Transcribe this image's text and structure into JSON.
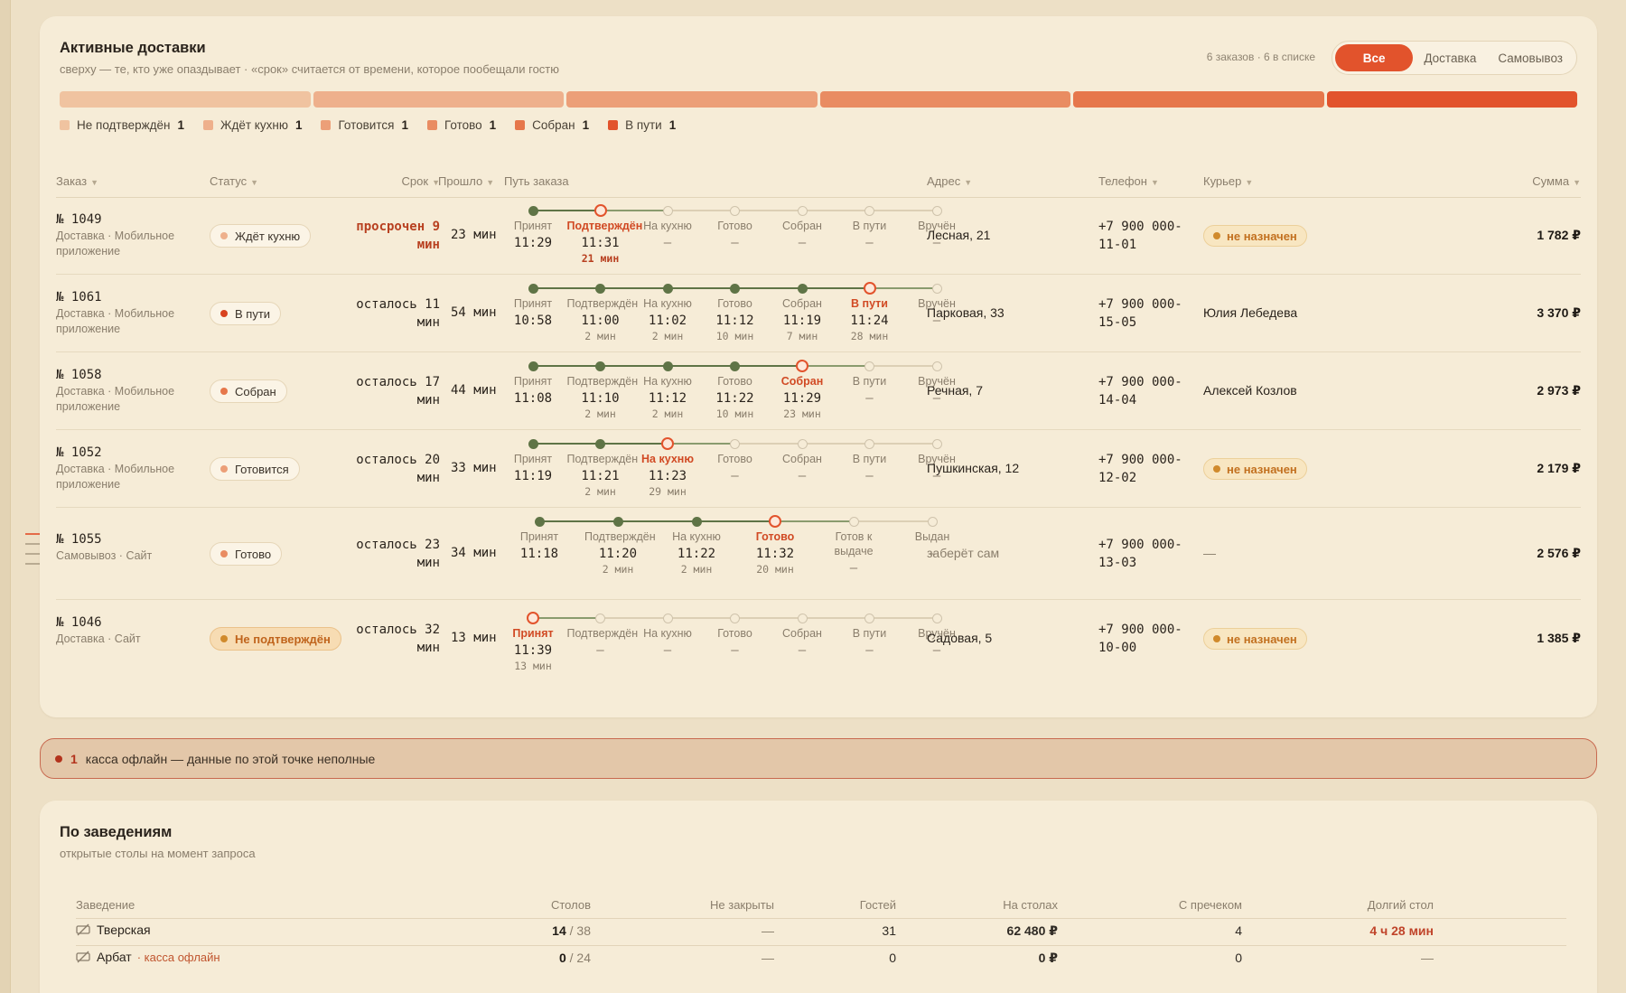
{
  "deliveries": {
    "title": "Активные доставки",
    "subtitle": "сверху — те, кто уже опаздывает · «срок» считается от времени, которое пообещали гостю",
    "counts": "6 заказов · 6 в списке",
    "filters": [
      "Все",
      "Доставка",
      "Самовывоз"
    ],
    "active_filter": "Все",
    "legend": [
      {
        "label": "Не подтверждён",
        "count": "1",
        "color": "#f0c3a0"
      },
      {
        "label": "Ждёт кухню",
        "count": "1",
        "color": "#eeb08c"
      },
      {
        "label": "Готовится",
        "count": "1",
        "color": "#ec9f78"
      },
      {
        "label": "Готово",
        "count": "1",
        "color": "#e98c62"
      },
      {
        "label": "Собран",
        "count": "1",
        "color": "#e6774b"
      },
      {
        "label": "В пути",
        "count": "1",
        "color": "#e2532c"
      }
    ],
    "columns": [
      "Заказ",
      "Статус",
      "Срок",
      "Прошло",
      "Путь заказа",
      "Адрес",
      "Телефон",
      "Курьер",
      "Сумма"
    ],
    "orders": [
      {
        "number": "№ 1049",
        "meta": "Доставка · Мобильное приложение",
        "status": "Ждёт кухню",
        "status_color": "#eeb08c",
        "status_warn": false,
        "deadline": "просрочен 9 мин",
        "late": true,
        "elapsed": "23 мин",
        "steps": [
          {
            "name": "Принят",
            "time": "11:29",
            "dur": ""
          },
          {
            "name": "Подтверждён",
            "time": "11:31",
            "dur": "21 мин"
          },
          {
            "name": "На кухню",
            "time": "—",
            "dur": ""
          },
          {
            "name": "Готово",
            "time": "—",
            "dur": ""
          },
          {
            "name": "Собран",
            "time": "—",
            "dur": ""
          },
          {
            "name": "В пути",
            "time": "—",
            "dur": ""
          },
          {
            "name": "Вручён",
            "time": "—",
            "dur": ""
          }
        ],
        "current": 1,
        "address": "Лесная, 21",
        "phone": "+7 900 000-11-01",
        "courier": "не назначен",
        "courier_unassigned": true,
        "sum": "1 782 ₽"
      },
      {
        "number": "№ 1061",
        "meta": "Доставка · Мобильное приложение",
        "status": "В пути",
        "status_color": "#d8421f",
        "status_warn": false,
        "deadline": "осталось 11 мин",
        "late": false,
        "elapsed": "54 мин",
        "steps": [
          {
            "name": "Принят",
            "time": "10:58",
            "dur": ""
          },
          {
            "name": "Подтверждён",
            "time": "11:00",
            "dur": "2 мин"
          },
          {
            "name": "На кухню",
            "time": "11:02",
            "dur": "2 мин"
          },
          {
            "name": "Готово",
            "time": "11:12",
            "dur": "10 мин"
          },
          {
            "name": "Собран",
            "time": "11:19",
            "dur": "7 мин"
          },
          {
            "name": "В пути",
            "time": "11:24",
            "dur": "28 мин"
          },
          {
            "name": "Вручён",
            "time": "—",
            "dur": ""
          }
        ],
        "current": 5,
        "address": "Парковая, 33",
        "phone": "+7 900 000-15-05",
        "courier": "Юлия Лебедева",
        "courier_unassigned": false,
        "sum": "3 370 ₽"
      },
      {
        "number": "№ 1058",
        "meta": "Доставка · Мобильное приложение",
        "status": "Собран",
        "status_color": "#e6774b",
        "status_warn": false,
        "deadline": "осталось 17 мин",
        "late": false,
        "elapsed": "44 мин",
        "steps": [
          {
            "name": "Принят",
            "time": "11:08",
            "dur": ""
          },
          {
            "name": "Подтверждён",
            "time": "11:10",
            "dur": "2 мин"
          },
          {
            "name": "На кухню",
            "time": "11:12",
            "dur": "2 мин"
          },
          {
            "name": "Готово",
            "time": "11:22",
            "dur": "10 мин"
          },
          {
            "name": "Собран",
            "time": "11:29",
            "dur": "23 мин"
          },
          {
            "name": "В пути",
            "time": "—",
            "dur": ""
          },
          {
            "name": "Вручён",
            "time": "—",
            "dur": ""
          }
        ],
        "current": 4,
        "address": "Речная, 7",
        "phone": "+7 900 000-14-04",
        "courier": "Алексей Козлов",
        "courier_unassigned": false,
        "sum": "2 973 ₽"
      },
      {
        "number": "№ 1052",
        "meta": "Доставка · Мобильное приложение",
        "status": "Готовится",
        "status_color": "#ec9f78",
        "status_warn": false,
        "deadline": "осталось 20 мин",
        "late": false,
        "elapsed": "33 мин",
        "steps": [
          {
            "name": "Принят",
            "time": "11:19",
            "dur": ""
          },
          {
            "name": "Подтверждён",
            "time": "11:21",
            "dur": "2 мин"
          },
          {
            "name": "На кухню",
            "time": "11:23",
            "dur": "29 мин"
          },
          {
            "name": "Готово",
            "time": "—",
            "dur": ""
          },
          {
            "name": "Собран",
            "time": "—",
            "dur": ""
          },
          {
            "name": "В пути",
            "time": "—",
            "dur": ""
          },
          {
            "name": "Вручён",
            "time": "—",
            "dur": ""
          }
        ],
        "current": 2,
        "address": "Пушкинская, 12",
        "phone": "+7 900 000-12-02",
        "courier": "не назначен",
        "courier_unassigned": true,
        "sum": "2 179 ₽"
      },
      {
        "number": "№ 1055",
        "meta": "Самовывоз · Сайт",
        "status": "Готово",
        "status_color": "#e98c62",
        "status_warn": false,
        "deadline": "осталось 23 мин",
        "late": false,
        "elapsed": "34 мин",
        "steps": [
          {
            "name": "Принят",
            "time": "11:18",
            "dur": ""
          },
          {
            "name": "Подтверждён",
            "time": "11:20",
            "dur": "2 мин"
          },
          {
            "name": "На кухню",
            "time": "11:22",
            "dur": "2 мин"
          },
          {
            "name": "Готово",
            "time": "11:32",
            "dur": "20 мин"
          },
          {
            "name": "Готов к выдаче",
            "time": "—",
            "dur": ""
          },
          {
            "name": "Выдан",
            "time": "—",
            "dur": ""
          }
        ],
        "current": 3,
        "address": "заберёт сам",
        "address_muted": true,
        "phone": "+7 900 000-13-03",
        "courier": "—",
        "courier_unassigned": false,
        "sum": "2 576 ₽"
      },
      {
        "number": "№ 1046",
        "meta": "Доставка · Сайт",
        "status": "Не подтверждён",
        "status_color": "#d08a2c",
        "status_warn": true,
        "deadline": "осталось 32 мин",
        "late": false,
        "elapsed": "13 мин",
        "steps": [
          {
            "name": "Принят",
            "time": "11:39",
            "dur": "13 мин"
          },
          {
            "name": "Подтверждён",
            "time": "—",
            "dur": ""
          },
          {
            "name": "На кухню",
            "time": "—",
            "dur": ""
          },
          {
            "name": "Готово",
            "time": "—",
            "dur": ""
          },
          {
            "name": "Собран",
            "time": "—",
            "dur": ""
          },
          {
            "name": "В пути",
            "time": "—",
            "dur": ""
          },
          {
            "name": "Вручён",
            "time": "—",
            "dur": ""
          }
        ],
        "current": 0,
        "address": "Садовая, 5",
        "phone": "+7 900 000-10-00",
        "courier": "не назначен",
        "courier_unassigned": true,
        "sum": "1 385 ₽"
      }
    ]
  },
  "alert": {
    "count": "1",
    "text": "касса офлайн — данные по этой точке неполные"
  },
  "venues": {
    "title": "По заведениям",
    "subtitle": "открытые столы на момент запроса",
    "columns": [
      "Заведение",
      "Столов",
      "Не закрыты",
      "Гостей",
      "На столах",
      "С пречеком",
      "Долгий стол"
    ],
    "rows": [
      {
        "name": "Тверская",
        "offline": "",
        "tables_open": "14",
        "tables_total": "/ 38",
        "unclosed": "—",
        "guests": "31",
        "on_tables": "62 480 ₽",
        "precheck": "4",
        "long_table": "4 ч 28 мин",
        "long_late": true
      },
      {
        "name": "Арбат",
        "offline": "· касса офлайн",
        "tables_open": "0",
        "tables_total": "/ 24",
        "unclosed": "—",
        "guests": "0",
        "on_tables": "0 ₽",
        "precheck": "0",
        "long_table": "—",
        "long_late": false
      }
    ]
  }
}
